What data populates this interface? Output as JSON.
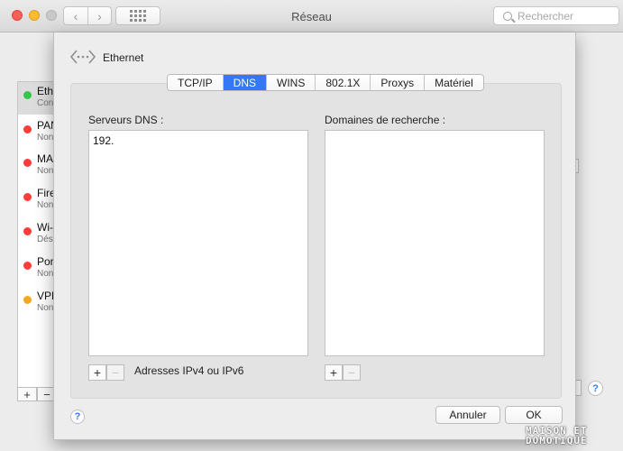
{
  "window": {
    "title": "Réseau",
    "search_placeholder": "Rechercher"
  },
  "sidebar": {
    "items": [
      {
        "name": "Eth",
        "status": "Con",
        "color": "#34c648",
        "selected": true
      },
      {
        "name": "PAN",
        "status": "Non",
        "color": "#fc3d39"
      },
      {
        "name": "MA",
        "status": "Non",
        "color": "#fc3d39"
      },
      {
        "name": "Fire",
        "status": "Non",
        "color": "#fc3d39"
      },
      {
        "name": "Wi-",
        "status": "Dés",
        "color": "#fc3d39"
      },
      {
        "name": "Por",
        "status": "Non",
        "color": "#fc3d39"
      },
      {
        "name": "VPN",
        "status": "Non",
        "color": "#f5a623"
      }
    ],
    "add_label": "+",
    "remove_label": "−"
  },
  "sheet": {
    "interface_name": "Ethernet",
    "tabs": [
      {
        "label": "TCP/IP",
        "active": false
      },
      {
        "label": "DNS",
        "active": true
      },
      {
        "label": "WINS",
        "active": false
      },
      {
        "label": "802.1X",
        "active": false
      },
      {
        "label": "Proxys",
        "active": false
      },
      {
        "label": "Matériel",
        "active": false
      }
    ],
    "dns_servers": {
      "label": "Serveurs DNS :",
      "entries": [
        "192."
      ],
      "add_label": "+",
      "remove_label": "−",
      "note": "Adresses IPv4 ou IPv6"
    },
    "search_domains": {
      "label": "Domaines de recherche :",
      "entries": [],
      "add_label": "+",
      "remove_label": "−"
    },
    "help_label": "?",
    "cancel_label": "Annuler",
    "ok_label": "OK"
  },
  "bg_help_label": "?",
  "watermark": {
    "line1": "MAISON ET",
    "line2": "DOMOTIQUE"
  },
  "colors": {
    "accent": "#3478f6",
    "status_connected": "#34c648",
    "status_disconnected": "#fc3d39",
    "status_inactive": "#f5a623"
  }
}
